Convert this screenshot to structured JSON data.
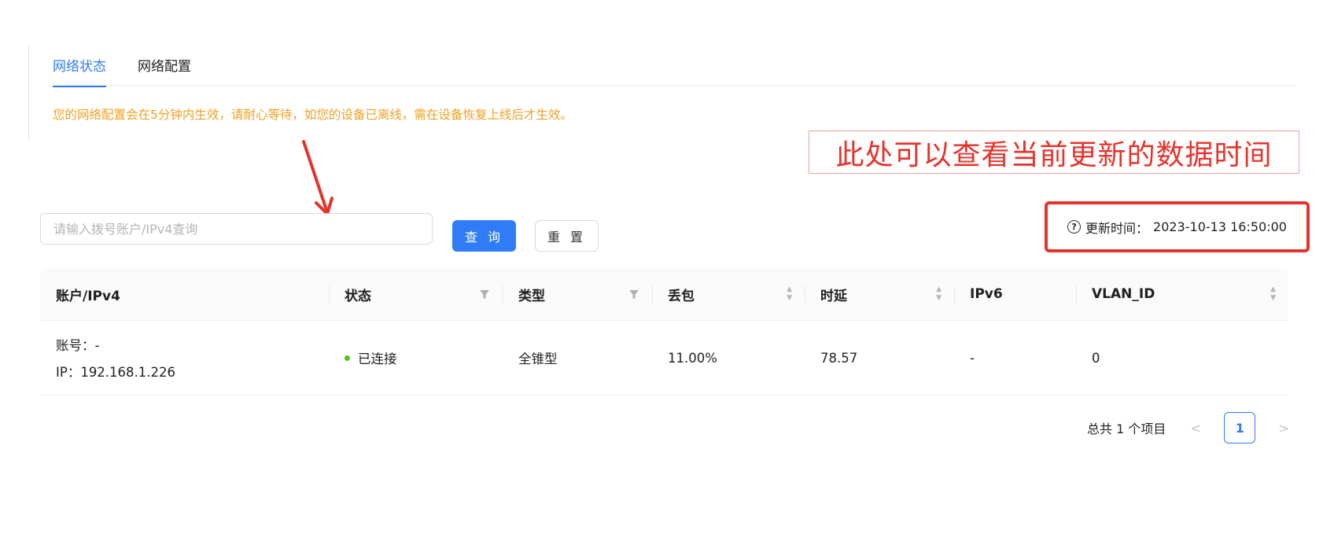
{
  "tabs": [
    {
      "label": "网络状态",
      "active": true
    },
    {
      "label": "网络配置",
      "active": false
    }
  ],
  "notice": "您的网络配置会在5分钟内生效，请耐心等待，如您的设备已离线，需在设备恢复上线后才生效。",
  "annotation": "此处可以查看当前更新的数据时间",
  "search": {
    "placeholder": "请输入拨号账户/IPv4查询",
    "value": ""
  },
  "buttons": {
    "query": "查 询",
    "reset": "重 置"
  },
  "update_time": {
    "label": "更新时间：",
    "value": "2023-10-13 16:50:00"
  },
  "table": {
    "columns": [
      "账户/IPv4",
      "状态",
      "类型",
      "丢包",
      "时延",
      "IPv6",
      "VLAN_ID"
    ],
    "rows": [
      {
        "account": "账号：-",
        "ip": "IP：192.168.1.226",
        "status": "已连接",
        "type": "全锥型",
        "loss": "11.00%",
        "latency": "78.57",
        "ipv6": "-",
        "vlan": "0"
      }
    ]
  },
  "pagination": {
    "total": "总共 1 个项目",
    "current": "1"
  },
  "colors": {
    "primary": "#2f7cf6",
    "warning": "#f0a020",
    "annotation": "#e5332a",
    "online": "#52c41a"
  }
}
